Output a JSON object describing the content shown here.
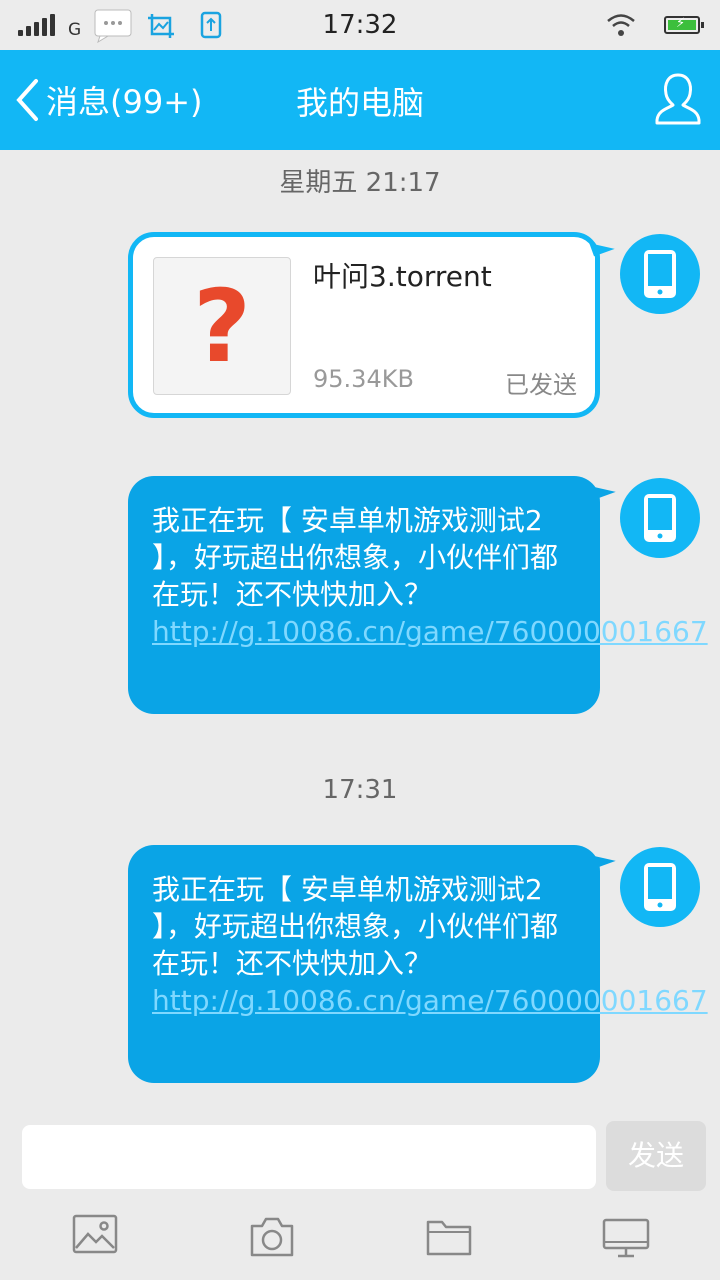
{
  "status_bar": {
    "time": "17:32",
    "network": "G"
  },
  "header": {
    "back_label": "消息(99+)",
    "title": "我的电脑"
  },
  "timestamps": [
    "星期五 21:17",
    "17:31"
  ],
  "file_message": {
    "name": "叶问3.torrent",
    "size": "95.34KB",
    "status": "已发送",
    "thumb_glyph": "?"
  },
  "messages": [
    {
      "text": "我正在玩【 安卓单机游戏测试2 】，好玩超出你想象，小伙伴们都在玩！还不快快加入？",
      "link": "http://g.10086.cn/game/760000001667"
    },
    {
      "text": "我正在玩【 安卓单机游戏测试2 】，好玩超出你想象，小伙伴们都在玩！还不快快加入？",
      "link": "http://g.10086.cn/game/760000001667"
    }
  ],
  "input_bar": {
    "send_label": "发送",
    "placeholder": ""
  },
  "toolbar": {
    "items": [
      "image-icon",
      "camera-icon",
      "folder-icon",
      "computer-icon"
    ]
  },
  "colors": {
    "accent": "#12b7f5",
    "bubble": "#0aa4e6",
    "background": "#ebebeb"
  }
}
